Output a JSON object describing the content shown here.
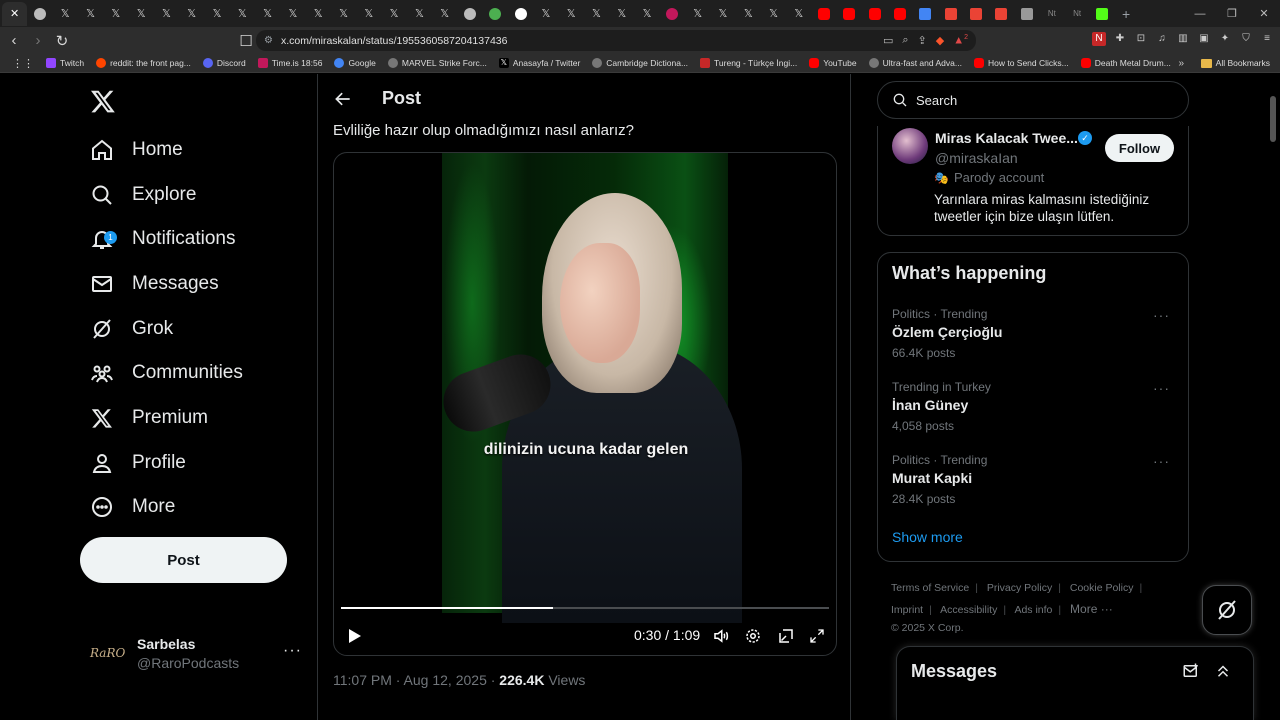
{
  "browser": {
    "tabs_count_label": "x",
    "url": "x.com/miraskalan/status/1955360587204137436",
    "bookmarks": [
      {
        "label": "Twitch",
        "color": "#9146ff"
      },
      {
        "label": "reddit: the front pag...",
        "color": "#ff4500"
      },
      {
        "label": "Discord",
        "color": "#5865f2"
      },
      {
        "label": "Time.is 18:56",
        "color": "#c2185b"
      },
      {
        "label": "Google",
        "color": "#4285f4"
      },
      {
        "label": "MARVEL Strike Forc...",
        "color": "#777777"
      },
      {
        "label": "Anasayfa / Twitter",
        "color": "#000000"
      },
      {
        "label": "Cambridge Dictiona...",
        "color": "#777777"
      },
      {
        "label": "Tureng - Türkçe İngi...",
        "color": "#c62828"
      },
      {
        "label": "YouTube",
        "color": "#ff0000"
      },
      {
        "label": "Ultra-fast and Adva...",
        "color": "#777777"
      },
      {
        "label": "How to Send Clicks...",
        "color": "#ff0000"
      },
      {
        "label": "Death Metal Drum...",
        "color": "#ff0000"
      }
    ],
    "all_bookmarks": "All Bookmarks",
    "extension_badge": "2"
  },
  "nav": {
    "items": [
      {
        "label": "Home"
      },
      {
        "label": "Explore"
      },
      {
        "label": "Notifications",
        "badge": "1"
      },
      {
        "label": "Messages"
      },
      {
        "label": "Grok"
      },
      {
        "label": "Communities"
      },
      {
        "label": "Premium"
      },
      {
        "label": "Profile"
      },
      {
        "label": "More"
      }
    ],
    "post_button": "Post",
    "account": {
      "name": "Sarbelas",
      "handle": "@RaroPodcasts",
      "avatar_text": "RaRO"
    }
  },
  "main": {
    "header": "Post",
    "tweet_text": "Evliliğe hazır olup olmadığımızı nasıl anlarız?",
    "video": {
      "subtitle": "dilinizin ucuna kadar gelen",
      "current_time": "0:30",
      "duration": "1:09",
      "time_display": "0:30 / 1:09",
      "progress_fraction": 0.435
    },
    "meta": {
      "time": "11:07 PM · Aug 12, 2025 · ",
      "views_count": "226.4K",
      "views_label": " Views"
    }
  },
  "right": {
    "search_placeholder": "Search",
    "profile_card": {
      "name": "Miras Kalacak Twee...",
      "handle": "@miraskaIan",
      "follow": "Follow",
      "parody": "Parody account",
      "bio": "Yarınlara miras kalmasını istediğiniz tweetler için bize ulaşın lütfen."
    },
    "trends": {
      "title": "What’s happening",
      "items": [
        {
          "context": "Politics · Trending",
          "name": "Özlem Çerçioğlu",
          "count": "66.4K posts"
        },
        {
          "context": "Trending in Turkey",
          "name": "İnan Güney",
          "count": "4,058 posts"
        },
        {
          "context": "Politics · Trending",
          "name": "Murat Kapki",
          "count": "28.4K posts"
        }
      ],
      "show_more": "Show more"
    },
    "footer": {
      "links": [
        "Terms of Service",
        "Privacy Policy",
        "Cookie Policy",
        "Imprint",
        "Accessibility",
        "Ads info",
        "More ···"
      ],
      "copyright": "© 2025 X Corp."
    }
  },
  "messages_drawer": {
    "title": "Messages"
  },
  "colors": {
    "accent": "#1d9bf0",
    "background": "#000000",
    "text": "#e7e9ea",
    "muted": "#71767b",
    "border": "#2f3336"
  }
}
